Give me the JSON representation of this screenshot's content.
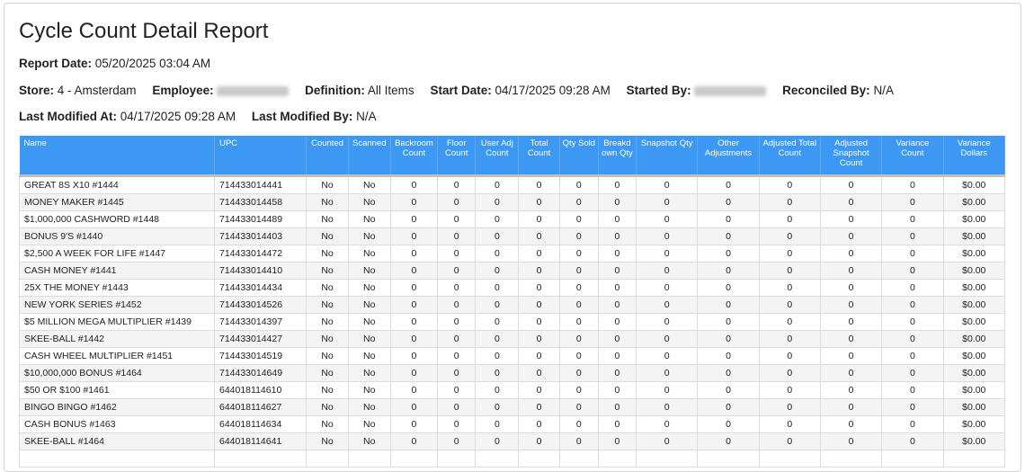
{
  "report": {
    "title": "Cycle Count Detail Report",
    "report_date_label": "Report Date:",
    "report_date": "05/20/2025 03:04 AM"
  },
  "meta": {
    "store_label": "Store:",
    "store": "4 - Amsterdam",
    "employee_label": "Employee:",
    "definition_label": "Definition:",
    "definition": "All Items",
    "start_date_label": "Start Date:",
    "start_date": "04/17/2025 09:28 AM",
    "started_by_label": "Started By:",
    "reconciled_by_label": "Reconciled By:",
    "reconciled_by": "N/A",
    "last_modified_at_label": "Last Modified At:",
    "last_modified_at": "04/17/2025 09:28 AM",
    "last_modified_by_label": "Last Modified By:",
    "last_modified_by": "N/A"
  },
  "table": {
    "headers": [
      "Name",
      "UPC",
      "Counted",
      "Scanned",
      "Backroom Count",
      "Floor Count",
      "User Adj Count",
      "Total Count",
      "Qty Sold",
      "Breakd own Qty",
      "Snapshot Qty",
      "Other Adjustments",
      "Adjusted Total Count",
      "Adjusted Snapshot Count",
      "Variance Count",
      "Variance Dollars"
    ],
    "rows": [
      [
        "GREAT 8S X10  #1444",
        "714433014441",
        "No",
        "No",
        "0",
        "0",
        "0",
        "0",
        "0",
        "0",
        "0",
        "0",
        "0",
        "0",
        "0",
        "$0.00"
      ],
      [
        "MONEY MAKER  #1445",
        "714433014458",
        "No",
        "No",
        "0",
        "0",
        "0",
        "0",
        "0",
        "0",
        "0",
        "0",
        "0",
        "0",
        "0",
        "$0.00"
      ],
      [
        "$1,000,000 CASHWORD #1448",
        "714433014489",
        "No",
        "No",
        "0",
        "0",
        "0",
        "0",
        "0",
        "0",
        "0",
        "0",
        "0",
        "0",
        "0",
        "$0.00"
      ],
      [
        "BONUS 9'S  #1440",
        "714433014403",
        "No",
        "No",
        "0",
        "0",
        "0",
        "0",
        "0",
        "0",
        "0",
        "0",
        "0",
        "0",
        "0",
        "$0.00"
      ],
      [
        "$2,500 A WEEK FOR LIFE  #1447",
        "714433014472",
        "No",
        "No",
        "0",
        "0",
        "0",
        "0",
        "0",
        "0",
        "0",
        "0",
        "0",
        "0",
        "0",
        "$0.00"
      ],
      [
        "CASH MONEY  #1441",
        "714433014410",
        "No",
        "No",
        "0",
        "0",
        "0",
        "0",
        "0",
        "0",
        "0",
        "0",
        "0",
        "0",
        "0",
        "$0.00"
      ],
      [
        "25X THE MONEY  #1443",
        "714433014434",
        "No",
        "No",
        "0",
        "0",
        "0",
        "0",
        "0",
        "0",
        "0",
        "0",
        "0",
        "0",
        "0",
        "$0.00"
      ],
      [
        "NEW YORK SERIES  #1452",
        "714433014526",
        "No",
        "No",
        "0",
        "0",
        "0",
        "0",
        "0",
        "0",
        "0",
        "0",
        "0",
        "0",
        "0",
        "$0.00"
      ],
      [
        "$5 MILLION MEGA MULTIPLIER  #1439",
        "714433014397",
        "No",
        "No",
        "0",
        "0",
        "0",
        "0",
        "0",
        "0",
        "0",
        "0",
        "0",
        "0",
        "0",
        "$0.00"
      ],
      [
        "SKEE-BALL  #1442",
        "714433014427",
        "No",
        "No",
        "0",
        "0",
        "0",
        "0",
        "0",
        "0",
        "0",
        "0",
        "0",
        "0",
        "0",
        "$0.00"
      ],
      [
        "CASH WHEEL MULTIPLIER  #1451",
        "714433014519",
        "No",
        "No",
        "0",
        "0",
        "0",
        "0",
        "0",
        "0",
        "0",
        "0",
        "0",
        "0",
        "0",
        "$0.00"
      ],
      [
        "$10,000,000 BONUS  #1464",
        "714433014649",
        "No",
        "No",
        "0",
        "0",
        "0",
        "0",
        "0",
        "0",
        "0",
        "0",
        "0",
        "0",
        "0",
        "$0.00"
      ],
      [
        "$50 OR $100  #1461",
        "644018114610",
        "No",
        "No",
        "0",
        "0",
        "0",
        "0",
        "0",
        "0",
        "0",
        "0",
        "0",
        "0",
        "0",
        "$0.00"
      ],
      [
        "BINGO BINGO  #1462",
        "644018114627",
        "No",
        "No",
        "0",
        "0",
        "0",
        "0",
        "0",
        "0",
        "0",
        "0",
        "0",
        "0",
        "0",
        "$0.00"
      ],
      [
        "CASH BONUS  #1463",
        "644018114634",
        "No",
        "No",
        "0",
        "0",
        "0",
        "0",
        "0",
        "0",
        "0",
        "0",
        "0",
        "0",
        "0",
        "$0.00"
      ],
      [
        "SKEE-BALL  #1464",
        "644018114641",
        "No",
        "No",
        "0",
        "0",
        "0",
        "0",
        "0",
        "0",
        "0",
        "0",
        "0",
        "0",
        "0",
        "$0.00"
      ],
      [
        "",
        "",
        "",
        "",
        "",
        "",
        "",
        "",
        "",
        "",
        "",
        "",
        "",
        "",
        "",
        ""
      ]
    ]
  }
}
